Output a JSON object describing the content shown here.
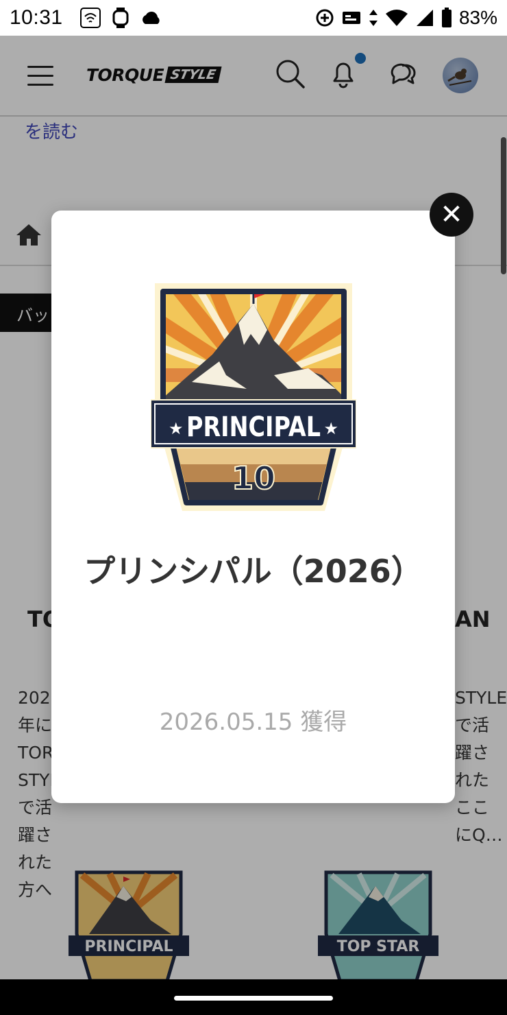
{
  "status_bar": {
    "time": "10:31",
    "battery": "83%",
    "icons": [
      "wifi-calling-icon",
      "watch-icon",
      "cloud-icon",
      "data-saver-icon",
      "sim-icon",
      "data-arrows-icon",
      "wifi-icon",
      "signal-icon",
      "battery-icon"
    ]
  },
  "header": {
    "logo_brand": "TORQUE",
    "logo_box": "STYLE",
    "icons": [
      "menu-icon",
      "search-icon",
      "bell-icon",
      "chat-icon",
      "avatar"
    ],
    "accent": "#1e6fb8"
  },
  "page": {
    "read_more": "を読む",
    "pill_label": "バッ",
    "left_card_title": "TO",
    "right_card_title": "AN",
    "left_card_desc": "2025年にTORQUE STYLEで活躍された方へ",
    "right_card_desc": "STYLEで活躍されたここにQ…",
    "badges": [
      "PRINCIPAL",
      "TOP STAR"
    ]
  },
  "modal": {
    "badge": {
      "banner_text": "PRINCIPAL",
      "number": "10"
    },
    "title": "プリンシパル（2026）",
    "date": "2026.05.15 獲得",
    "close_label": "✕"
  }
}
